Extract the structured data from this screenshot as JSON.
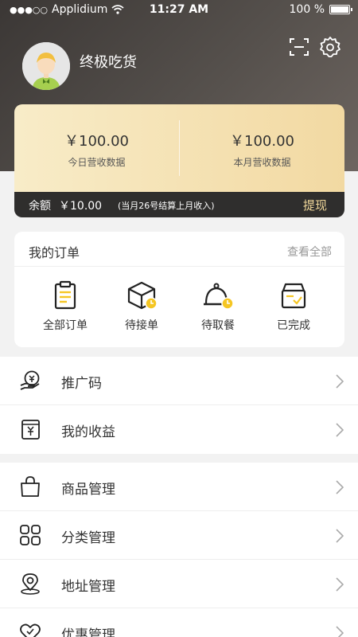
{
  "status_bar": {
    "carrier": "Applidium",
    "time": "11:27 AM",
    "battery": "100 %"
  },
  "profile": {
    "username": "终极吃货"
  },
  "income": {
    "today_value": "￥100.00",
    "today_label": "今日营收数据",
    "month_value": "￥100.00",
    "month_label": "本月营收数据"
  },
  "balance": {
    "label": "余额",
    "value": "￥10.00",
    "note": "(当月26号结算上月收入)",
    "withdraw": "提现"
  },
  "orders": {
    "title": "我的订单",
    "view_all": "查看全部",
    "items": [
      {
        "label": "全部订单",
        "icon": "clipboard-icon"
      },
      {
        "label": "待接单",
        "icon": "box-pending-icon"
      },
      {
        "label": "待取餐",
        "icon": "cloche-pending-icon"
      },
      {
        "label": "已完成",
        "icon": "box-check-icon"
      }
    ]
  },
  "menu_group1": [
    {
      "label": "推广码",
      "icon": "promo-code-icon"
    },
    {
      "label": "我的收益",
      "icon": "earnings-icon"
    }
  ],
  "menu_group2": [
    {
      "label": "商品管理",
      "icon": "shopping-bag-icon"
    },
    {
      "label": "分类管理",
      "icon": "grid-icon"
    },
    {
      "label": "地址管理",
      "icon": "location-icon"
    },
    {
      "label": "优惠管理",
      "icon": "heart-coupon-icon"
    }
  ],
  "colors": {
    "accent_gold": "#f1d89a",
    "badge_yellow": "#f5c623",
    "header_dark": "#3b3735"
  }
}
